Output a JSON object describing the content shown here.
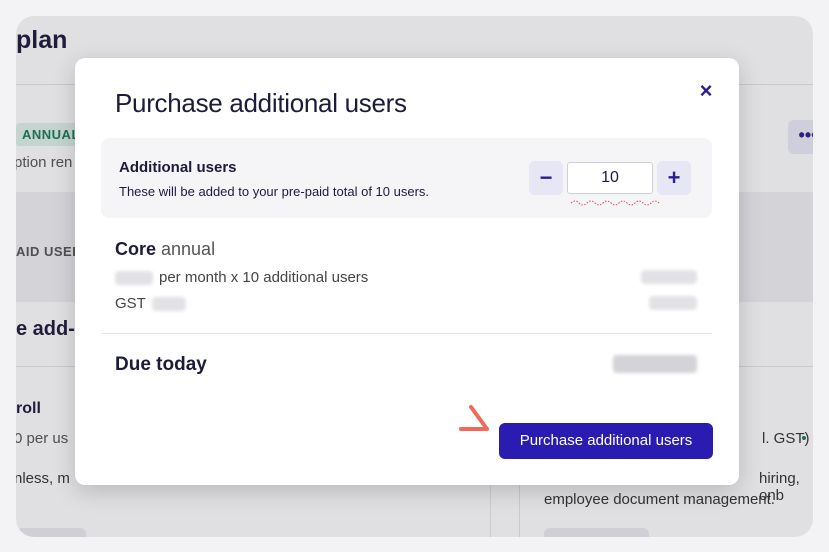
{
  "background": {
    "page_title": "plan",
    "badge": "ANNUAL",
    "subscription_text": "ption ren",
    "more_icon": "•••",
    "paid_users_label": "AID USER",
    "addons_title": "e add-",
    "addon_name": "roll",
    "addon_price": "0 per us",
    "addon_desc": "nless, m",
    "right_price_text": "l. GST)",
    "right_desc_fragment": "hiring, onb",
    "right_desc_line2": "employee document management."
  },
  "modal": {
    "title": "Purchase additional users",
    "close_icon": "×",
    "additional_users": {
      "label": "Additional users",
      "help": "These will be added to your pre-paid total of 10 users.",
      "quantity": "10",
      "decrement_icon": "−",
      "increment_icon": "+"
    },
    "core": {
      "name": "Core",
      "plan": "annual",
      "per_month_text": "per month x 10 additional users",
      "gst_label": "GST"
    },
    "due_today_label": "Due today",
    "purchase_button": "Purchase additional users"
  },
  "colors": {
    "accent": "#2a1cb0",
    "badge_bg": "#dff3ea",
    "badge_text": "#1c7a56",
    "annotation_arrow": "#f06a5a"
  }
}
